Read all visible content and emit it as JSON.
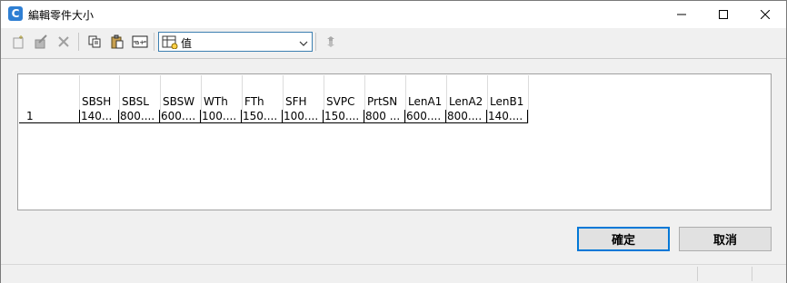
{
  "window": {
    "title": "編輯零件大小",
    "app_icon_letter": "C"
  },
  "toolbar": {
    "combo_value": "值",
    "icons": [
      "new-row-icon",
      "edit-icon",
      "delete-icon",
      "copy-icon",
      "paste-icon",
      "resize-columns-icon",
      "table-view-icon",
      "refresh-icon"
    ]
  },
  "grid": {
    "columns": [
      "SBSH",
      "SBSL",
      "SBSW",
      "WTh",
      "FTh",
      "SFH",
      "SVPC",
      "PrtSN",
      "LenA1",
      "LenA2",
      "LenB1"
    ],
    "rows": [
      {
        "index": "1",
        "cells": [
          "140...",
          "800....",
          "600....",
          "100....",
          "150....",
          "100....",
          "150....",
          "800 ...",
          "600....",
          "800....",
          "140...."
        ]
      }
    ]
  },
  "buttons": {
    "ok_label": "確定",
    "cancel_label": "取消"
  },
  "colors": {
    "accent": "#0078d7",
    "app_icon": "#2f7fd3"
  }
}
